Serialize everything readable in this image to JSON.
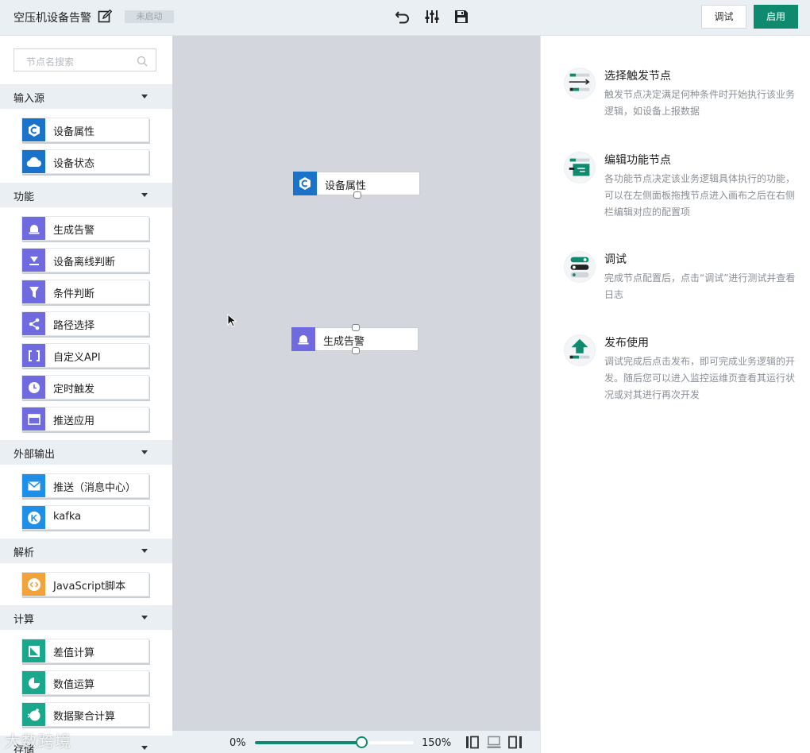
{
  "header": {
    "title": "空压机设备告警",
    "status": "未启动",
    "debug_label": "调试",
    "enable_label": "启用",
    "accent": "#0f8a6e"
  },
  "sidebar": {
    "search_placeholder": "节点名搜索",
    "categories": [
      {
        "label": "输入源",
        "items": [
          {
            "label": "设备属性",
            "icon": "device-property-icon",
            "color": "#1a73c8"
          },
          {
            "label": "设备状态",
            "icon": "cloud-icon",
            "color": "#1a73c8"
          }
        ]
      },
      {
        "label": "功能",
        "items": [
          {
            "label": "生成告警",
            "icon": "alarm-icon",
            "color": "#6f6adf"
          },
          {
            "label": "设备离线判断",
            "icon": "offline-icon",
            "color": "#6f6adf"
          },
          {
            "label": "条件判断",
            "icon": "filter-icon",
            "color": "#6f6adf"
          },
          {
            "label": "路径选择",
            "icon": "share-icon",
            "color": "#6f6adf"
          },
          {
            "label": "自定义API",
            "icon": "bracket-icon",
            "color": "#6f6adf"
          },
          {
            "label": "定时触发",
            "icon": "clock-icon",
            "color": "#6f6adf"
          },
          {
            "label": "推送应用",
            "icon": "app-icon",
            "color": "#6f6adf"
          }
        ]
      },
      {
        "label": "外部输出",
        "items": [
          {
            "label": "推送（消息中心）",
            "icon": "mail-icon",
            "color": "#1e8ee6"
          },
          {
            "label": "kafka",
            "icon": "kafka-icon",
            "color": "#1e8ee6"
          }
        ]
      },
      {
        "label": "解析",
        "items": [
          {
            "label": "JavaScript脚本",
            "icon": "code-icon",
            "color": "#f2a23a"
          }
        ]
      },
      {
        "label": "计算",
        "items": [
          {
            "label": "差值计算",
            "icon": "diff-icon",
            "color": "#19a88c"
          },
          {
            "label": "数值运算",
            "icon": "pie-icon",
            "color": "#19a88c"
          },
          {
            "label": "数据聚合计算",
            "icon": "aggregate-icon",
            "color": "#19a88c"
          }
        ]
      },
      {
        "label": "存储",
        "items": []
      }
    ]
  },
  "canvas": {
    "nodes": [
      {
        "label": "设备属性",
        "icon": "device-property-icon",
        "color": "#1a73c8"
      },
      {
        "label": "生成告警",
        "icon": "alarm-icon",
        "color": "#6f6adf"
      }
    ]
  },
  "zoom": {
    "min_label": "0%",
    "max_label": "150%",
    "value_fraction": 0.67
  },
  "panel": {
    "steps": [
      {
        "title": "选择触发节点",
        "desc": "触发节点决定满足何种条件时开始执行该业务逻辑，如设备上报数据"
      },
      {
        "title": "编辑功能节点",
        "desc": "各功能节点决定该业务逻辑具体执行的功能，可以在左侧面板拖拽节点进入画布之后在右侧栏编辑对应的配置项"
      },
      {
        "title": "调试",
        "desc": "完成节点配置后，点击“调试”进行测试并查看日志"
      },
      {
        "title": "发布使用",
        "desc": "调试完成后点击发布，即可完成业务逻辑的开发。随后您可以进入监控运维页查看其运行状况或对其进行再次开发"
      }
    ]
  },
  "watermark": "大数跨境"
}
